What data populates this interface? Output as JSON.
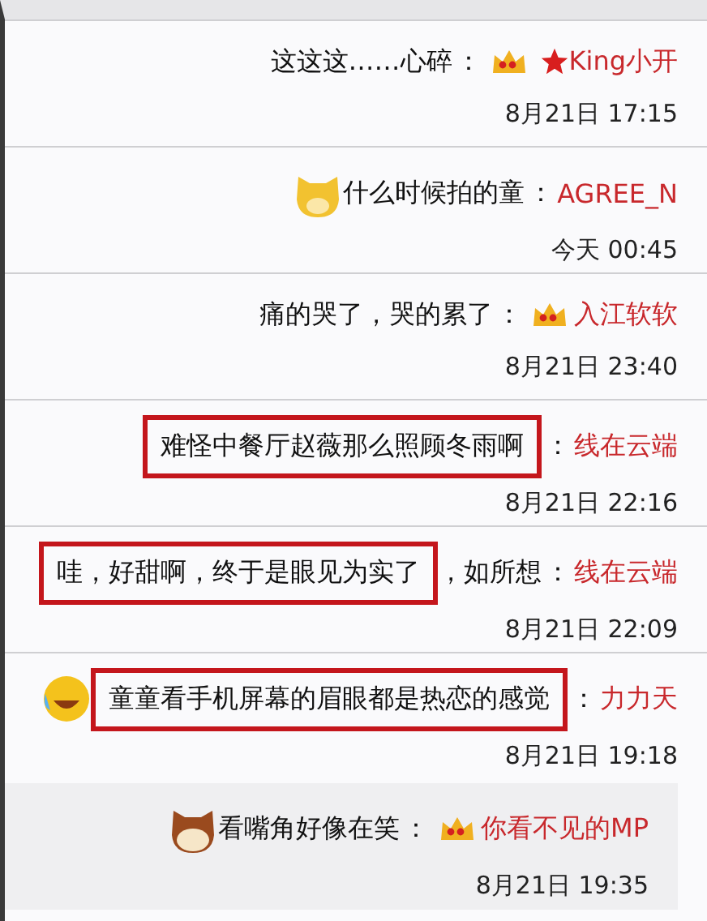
{
  "comments": [
    {
      "name": "King小开",
      "star": true,
      "crown": true,
      "colon": "：",
      "message": [
        {
          "text": "这这这……心碎",
          "boxed": false
        }
      ],
      "time": "8月21日 17:15",
      "selected": false
    },
    {
      "name": "AGREE_N",
      "star": false,
      "crown": false,
      "colon": "：",
      "message": [
        {
          "text": "什么时候拍的童",
          "boxed": false
        }
      ],
      "emoji": {
        "kind": "doge"
      },
      "time": "今天 00:45",
      "selected": false
    },
    {
      "name": "入江软软",
      "star": false,
      "crown": true,
      "colon": "：",
      "message": [
        {
          "text": "痛的哭了，哭的累了",
          "boxed": false
        }
      ],
      "time": "8月21日 23:40",
      "selected": false
    },
    {
      "name": "线在云端",
      "star": false,
      "crown": false,
      "colon": "：",
      "message": [
        {
          "text": "难怪中餐厅赵薇那么照顾冬雨啊",
          "boxed": true
        }
      ],
      "time": "8月21日 22:16",
      "selected": false
    },
    {
      "name": "线在云端",
      "star": false,
      "crown": false,
      "colon": "：",
      "message": [
        {
          "text": "哇，好甜啊，终于是眼见为实了",
          "boxed": true
        },
        {
          "text": "，如所想",
          "boxed": false
        }
      ],
      "time": "8月21日 22:09",
      "selected": false
    },
    {
      "name": "力力天",
      "star": false,
      "crown": false,
      "colon": "：",
      "message": [
        {
          "text": "童童看手机屏幕的眉眼都是热恋的感觉",
          "boxed": true
        }
      ],
      "emoji": {
        "kind": "laugh"
      },
      "time": "8月21日 19:18",
      "selected": false
    },
    {
      "name": "你看不见的MP",
      "star": false,
      "crown": true,
      "colon": "：",
      "message": [
        {
          "text": "看嘴角好像在笑",
          "boxed": false
        }
      ],
      "emoji": {
        "kind": "dog"
      },
      "time": "8月21日 19:35",
      "selected": true
    }
  ]
}
